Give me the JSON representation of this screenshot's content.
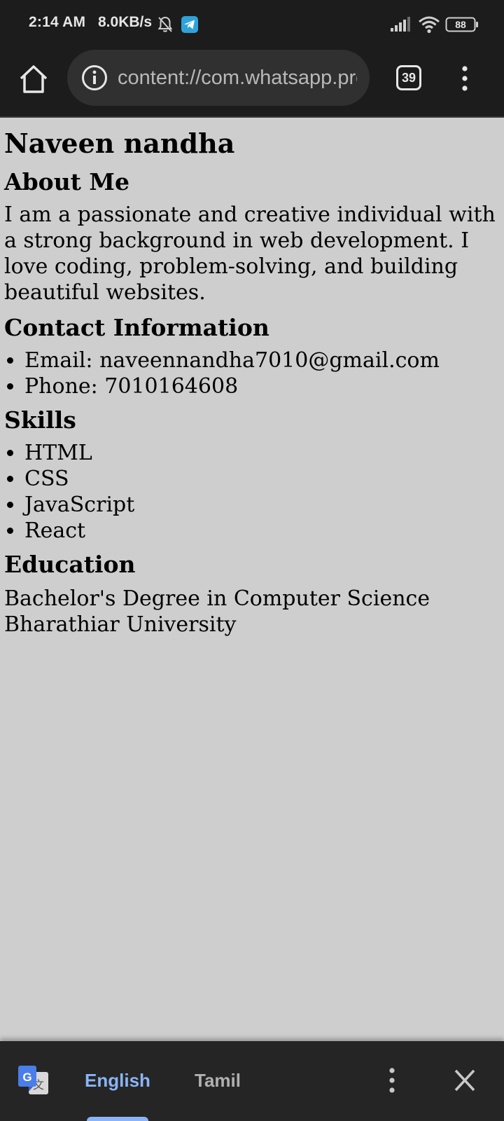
{
  "status_bar": {
    "time": "2:14 AM",
    "network_speed": "8.0KB/s",
    "battery_level": "88",
    "icons": [
      "mute-bell-icon",
      "telegram-icon",
      "signal-icon",
      "wifi-icon",
      "battery-icon"
    ]
  },
  "toolbar": {
    "url": "content://com.whatsapp.provider.media/item/",
    "tab_count": "39",
    "icons": [
      "home-icon",
      "info-icon",
      "tabs-icon",
      "more-vert-icon"
    ]
  },
  "page": {
    "name": "Naveen nandha",
    "about_heading": "About Me",
    "about_text": "I am a passionate and creative individual with a strong background in web development. I love coding, problem-solving, and building beautiful websites.",
    "contact_heading": "Contact Information",
    "contact_items": [
      "Email: naveennandha7010@gmail.com",
      "Phone: 7010164608"
    ],
    "skills_heading": "Skills",
    "skills": [
      "HTML",
      "CSS",
      "JavaScript",
      "React"
    ],
    "education_heading": "Education",
    "education_degree": "Bachelor's Degree in Computer Science",
    "education_university": "Bharathiar University"
  },
  "translate_bar": {
    "source_language": "English",
    "target_language": "Tamil",
    "selected": "English",
    "accent_color": "#8ab4f8",
    "icons": [
      "google-translate-icon",
      "more-vert-icon",
      "close-icon"
    ]
  }
}
